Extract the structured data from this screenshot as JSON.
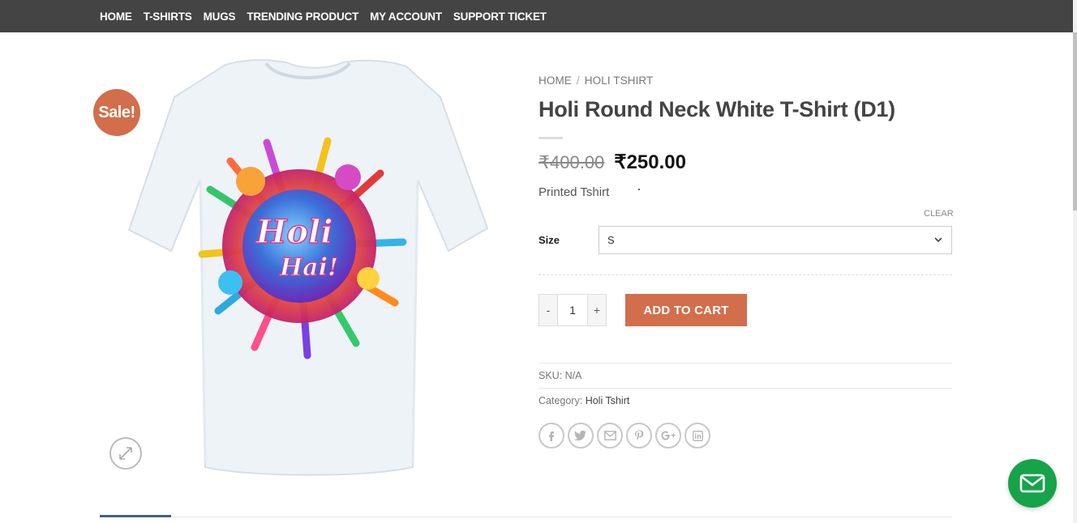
{
  "nav": {
    "items": [
      "HOME",
      "T-SHIRTS",
      "MUGS",
      "TRENDING PRODUCT",
      "MY ACCOUNT",
      "SUPPORT TICKET"
    ]
  },
  "product": {
    "sale_badge": "Sale!",
    "breadcrumb": [
      "HOME",
      "HOLI TSHIRT"
    ],
    "breadcrumb_sep": "/",
    "title": "Holi Round Neck White T-Shirt (D1)",
    "price_old": "₹400.00",
    "price_new": "₹250.00",
    "description": "Printed Tshirt",
    "clear_label": "CLEAR",
    "size_label": "Size",
    "size_value": "S",
    "qty_minus": "-",
    "qty_value": "1",
    "qty_plus": "+",
    "add_to_cart": "ADD TO CART",
    "sku_label": "SKU:",
    "sku_value": "N/A",
    "category_label": "Category:",
    "category_value": "Holi Tshirt",
    "image_text_line1": "Holi",
    "image_text_line2": "Hai!"
  },
  "colors": {
    "topbar": "#444444",
    "accent": "#d26e4b",
    "message_button": "#16a34a"
  },
  "share_icons": [
    "facebook-icon",
    "twitter-icon",
    "email-icon",
    "pinterest-icon",
    "google-plus-icon",
    "linkedin-icon"
  ]
}
